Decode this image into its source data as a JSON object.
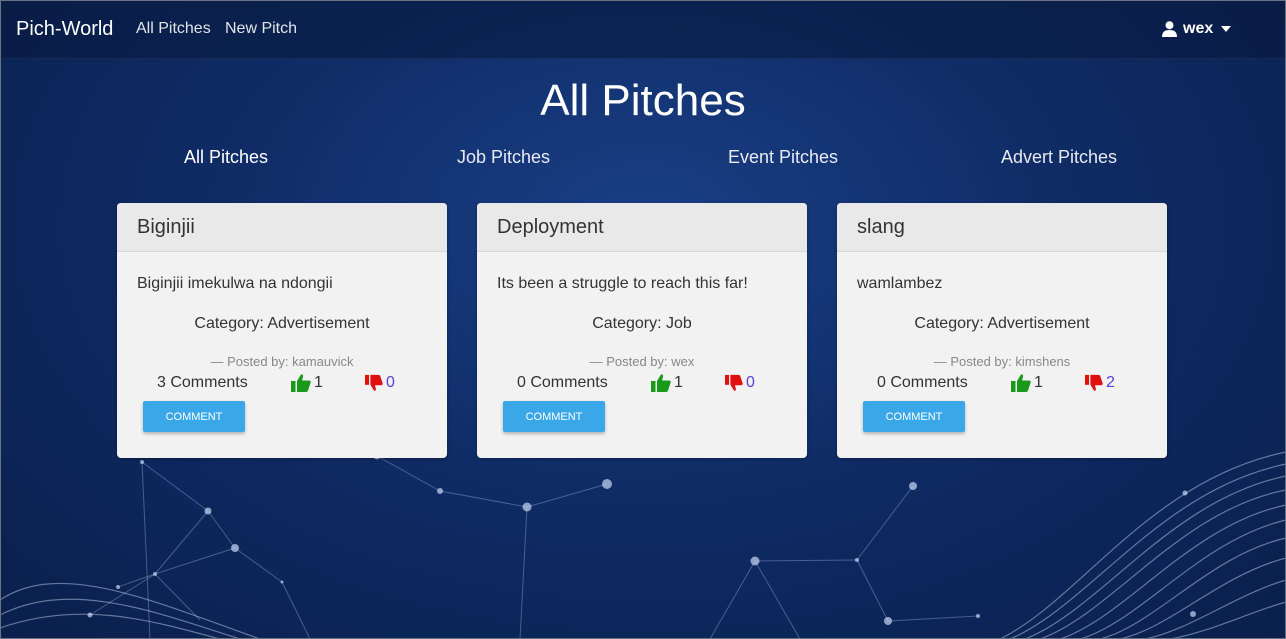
{
  "navbar": {
    "brand": "Pich-World",
    "links": [
      "All Pitches",
      "New Pitch"
    ],
    "user": "wex"
  },
  "page_title": "All Pitches",
  "categories": [
    "All Pitches",
    "Job Pitches",
    "Event Pitches",
    "Advert Pitches"
  ],
  "cards": [
    {
      "title": "Biginjii",
      "description": "Biginjii imekulwa na ndongii",
      "category": "Category: Advertisement",
      "posted_by": "— Posted by: kamauvick",
      "comments": "3 Comments",
      "likes": "1",
      "dislikes": "0",
      "button": "COMMENT"
    },
    {
      "title": "Deployment",
      "description": "Its been a struggle to reach this far!",
      "category": "Category: Job",
      "posted_by": "— Posted by: wex",
      "comments": "0 Comments",
      "likes": "1",
      "dislikes": "0",
      "button": "COMMENT"
    },
    {
      "title": "slang",
      "description": "wamlambez",
      "category": "Category: Advertisement",
      "posted_by": "— Posted by: kimshens",
      "comments": "0 Comments",
      "likes": "1",
      "dislikes": "2",
      "button": "COMMENT"
    }
  ],
  "icons": {
    "user": "user-icon",
    "caret": "caret-down-icon",
    "like": "thumbs-up-icon",
    "dislike": "thumbs-down-icon"
  },
  "colors": {
    "background": "#0f2c66",
    "card": "#f2f2f2",
    "comment_button": "#3aa8e8",
    "like": "#1a9a1a",
    "dislike": "#e01010",
    "dislike_count": "#5a3fd6"
  }
}
